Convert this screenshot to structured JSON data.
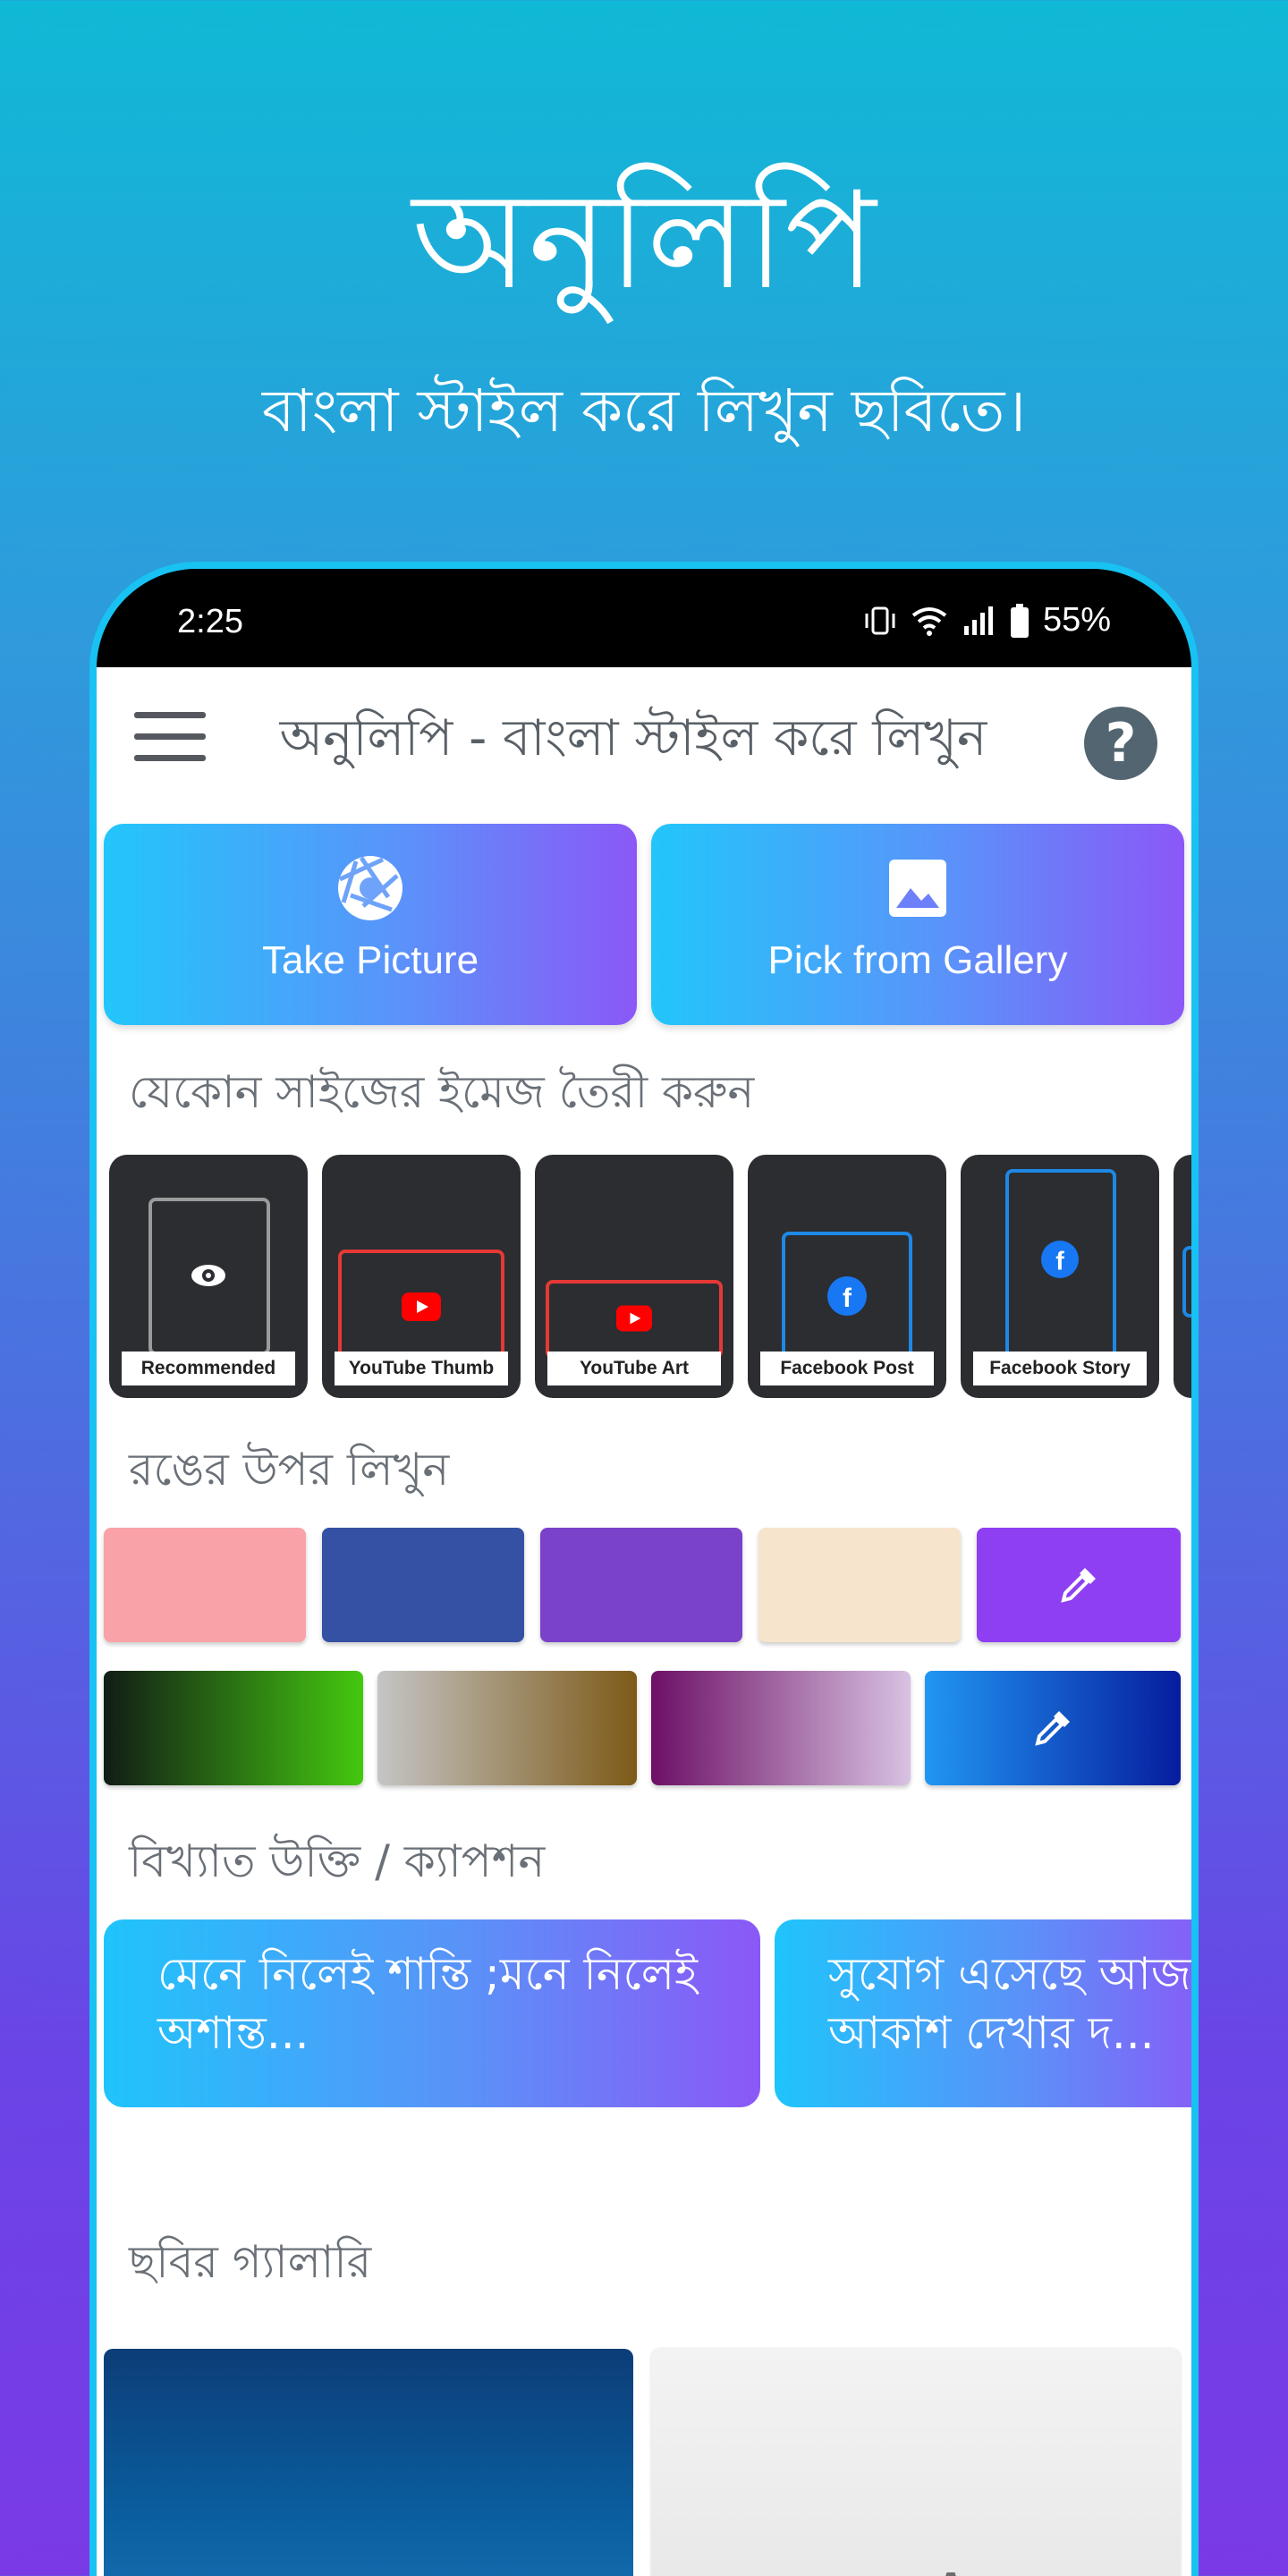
{
  "hero": {
    "title": "অনুলিপি",
    "subtitle": "বাংলা স্টাইল করে লিখুন ছবিতে।"
  },
  "status_bar": {
    "time": "2:25",
    "battery": "55%",
    "icons": [
      "vibrate-icon",
      "wifi-icon",
      "signal-icon",
      "battery-icon"
    ]
  },
  "app_bar": {
    "title": "অনুলিপি - বাংলা স্টাইল করে লিখুন",
    "menu_icon": "hamburger-menu-icon",
    "help_label": "?"
  },
  "actions": {
    "take_picture": "Take Picture",
    "pick_gallery": "Pick from Gallery"
  },
  "sections": {
    "sizes": "যেকোন সাইজের ইমেজ তৈরী করুন",
    "colors": "রঙের উপর লিখুন",
    "quotes": "বিখ্যাত উক্তি / ক্যাপশন",
    "gallery": "ছবির গ্যালারি"
  },
  "size_presets": [
    {
      "label": "Recommended",
      "icon": "eye-icon"
    },
    {
      "label": "YouTube Thumb",
      "icon": "youtube-icon"
    },
    {
      "label": "YouTube Art",
      "icon": "youtube-icon"
    },
    {
      "label": "Facebook Post",
      "icon": "facebook-icon"
    },
    {
      "label": "Facebook Story",
      "icon": "facebook-icon"
    }
  ],
  "solid_colors": [
    "#f9a2a8",
    "#3451a3",
    "#7a42c8",
    "#f7e4cc"
  ],
  "solid_picker_color": "#8e3ff2",
  "gradient_colors": [
    [
      "#121c16",
      "#44c810"
    ],
    [
      "#c5c5c5",
      "#7d5a18"
    ],
    [
      "#6d1066",
      "#d8c2e2"
    ]
  ],
  "gradient_picker_colors": [
    "#2196f3",
    "#061d9e"
  ],
  "quotes": [
    "মেনে নিলেই শান্তি ;মনে নিলেই অশান্ত...",
    "সুযোগ এসেছে আজ, আকাশ দেখার দ..."
  ]
}
